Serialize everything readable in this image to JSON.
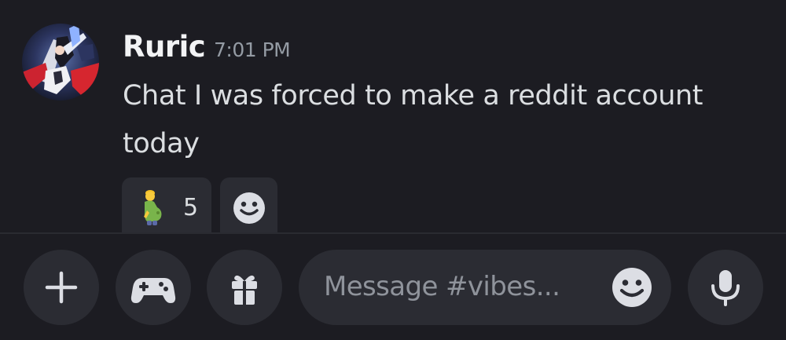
{
  "message": {
    "author": "Ruric",
    "timestamp": "7:01 PM",
    "text": "Chat I was forced to make a reddit account today",
    "reactions": [
      {
        "emoji": "pregnant-man-emoji",
        "count": "5"
      }
    ],
    "add_reaction_icon": "smiley-icon"
  },
  "composer": {
    "placeholder": "Message #vibes...",
    "buttons": [
      "plus-icon",
      "gamepad-icon",
      "gift-icon"
    ],
    "emoji_icon": "smiley-icon",
    "mic_icon": "microphone-icon"
  },
  "colors": {
    "background": "#1c1c22",
    "surface": "#2b2c33",
    "author": "#f2f3f5",
    "text": "#dbdee1",
    "muted": "#949ba4"
  }
}
